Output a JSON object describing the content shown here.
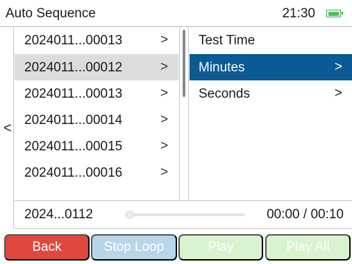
{
  "status": {
    "title": "Auto Sequence",
    "time": "21:30",
    "battery_level": 1.0,
    "battery_color": "#52c05d"
  },
  "nav": {
    "back_glyph": "<"
  },
  "sequences": {
    "selected_index": 1,
    "items": [
      {
        "label": "2024011...00013",
        "chevron": ">"
      },
      {
        "label": "2024011...00012",
        "chevron": ">"
      },
      {
        "label": "2024011...00013",
        "chevron": ">"
      },
      {
        "label": "2024011...00014",
        "chevron": ">"
      },
      {
        "label": "2024011...00015",
        "chevron": ">"
      },
      {
        "label": "2024011...00016",
        "chevron": ">"
      }
    ]
  },
  "settings": {
    "header": "Test Time",
    "items": [
      {
        "label": "Minutes",
        "chevron": ">",
        "selected": true
      },
      {
        "label": "Seconds",
        "chevron": ">",
        "selected": false
      }
    ],
    "selected_color": "#0a5a94"
  },
  "player": {
    "file": "2024...0112",
    "time": "00:00 / 00:10",
    "progress": 0.0
  },
  "buttons": {
    "back": "Back",
    "stop_loop": "Stop Loop",
    "play": "Play",
    "play_all": "Play All",
    "back_color": "#e0473e",
    "stop_loop_color": "#b8d6ea",
    "play_color": "#d9f2d0"
  }
}
